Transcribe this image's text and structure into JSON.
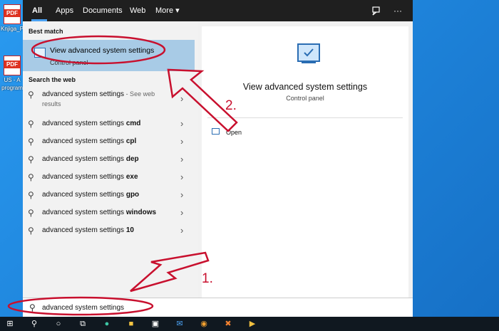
{
  "desktop": {
    "icons": [
      {
        "badge": "PDF",
        "label": "Knjiga_P"
      },
      {
        "badge": "PDF",
        "label": "US - A"
      },
      {
        "label_line2": "program"
      }
    ]
  },
  "tabs": [
    {
      "label": "All",
      "active": true
    },
    {
      "label": "Apps"
    },
    {
      "label": "Documents"
    },
    {
      "label": "Web"
    },
    {
      "label": "More ▾"
    }
  ],
  "topbar_icons": {
    "feedback": "feedback-icon",
    "more": "···"
  },
  "best_match": {
    "section_title": "Best match",
    "title": "View advanced system settings",
    "subtitle": "Control panel"
  },
  "web_search": {
    "section_title": "Search the web",
    "items": [
      {
        "prefix": "advanced system settings",
        "bold": "",
        "suffix": " - See web",
        "line2": "results"
      },
      {
        "prefix": "advanced system settings ",
        "bold": "cmd"
      },
      {
        "prefix": "advanced system settings ",
        "bold": "cpl"
      },
      {
        "prefix": "advanced system settings ",
        "bold": "dep"
      },
      {
        "prefix": "advanced system settings ",
        "bold": "exe"
      },
      {
        "prefix": "advanced system settings ",
        "bold": "gpo"
      },
      {
        "prefix": "advanced system settings ",
        "bold": "windows"
      },
      {
        "prefix": "advanced system settings ",
        "bold": "10"
      }
    ]
  },
  "preview": {
    "title": "View advanced system settings",
    "subtitle": "Control panel",
    "actions": [
      {
        "label": "Open"
      }
    ]
  },
  "search": {
    "value": "advanced system settings"
  },
  "annotations": {
    "step1": "1.",
    "step2": "2.",
    "color": "#c8102e"
  },
  "taskbar": {
    "icons": [
      "start-icon",
      "search-icon",
      "cortana-icon",
      "task-view-icon",
      "edge-icon",
      "file-explorer-icon",
      "store-icon",
      "mail-icon",
      "chrome-icon",
      "xampp-icon",
      "media-icon"
    ]
  }
}
